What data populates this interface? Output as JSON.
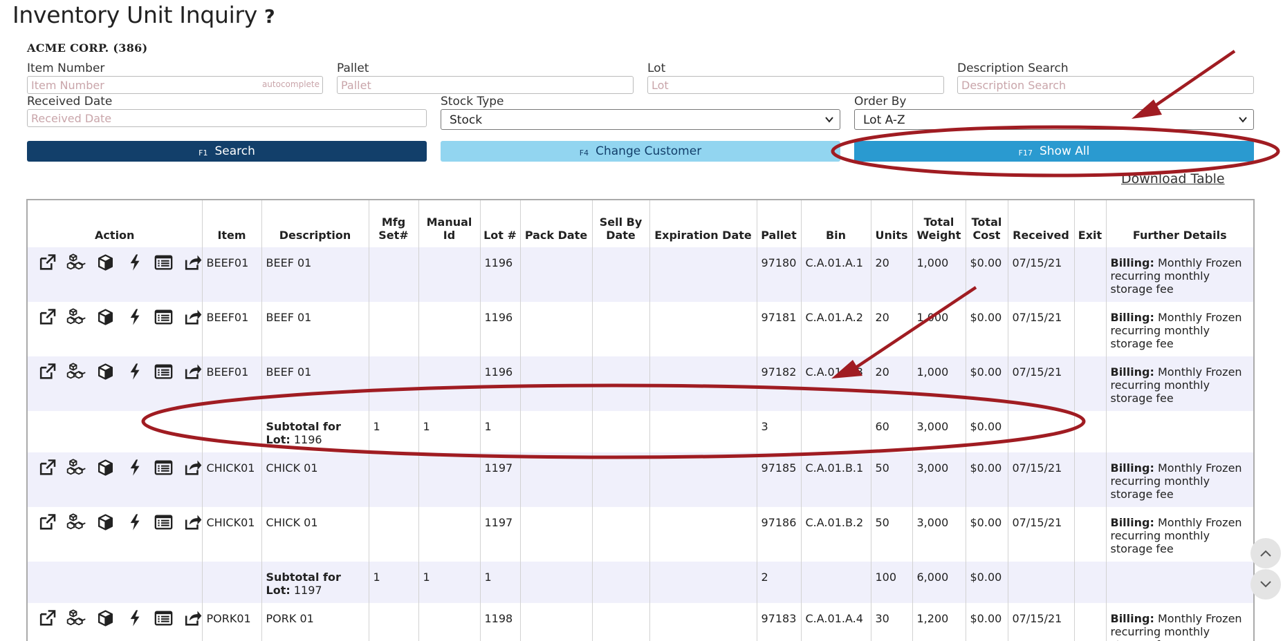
{
  "page": {
    "title": "Inventory Unit Inquiry",
    "help": "?",
    "customer": "ACME CORP. (386)"
  },
  "filters": {
    "item_number": {
      "label": "Item Number",
      "placeholder": "Item Number",
      "hint": "autocomplete"
    },
    "pallet": {
      "label": "Pallet",
      "placeholder": "Pallet"
    },
    "lot": {
      "label": "Lot",
      "placeholder": "Lot"
    },
    "description_search": {
      "label": "Description Search",
      "placeholder": "Description Search"
    },
    "received_date": {
      "label": "Received Date",
      "placeholder": "Received Date"
    },
    "stock_type": {
      "label": "Stock Type",
      "value": "Stock"
    },
    "order_by": {
      "label": "Order By",
      "value": "Lot A-Z"
    }
  },
  "buttons": {
    "search": {
      "fkey": "F1",
      "label": "Search"
    },
    "change_customer": {
      "fkey": "F4",
      "label": "Change Customer"
    },
    "show_all": {
      "fkey": "F17",
      "label": "Show All"
    },
    "download": "Download Table"
  },
  "colors": {
    "search_button": "#123f6a",
    "change_customer_button": "#92d5f0",
    "show_all_button": "#2a9ad0",
    "annotation": "#a01c22",
    "row_alt": "#f0f0fb"
  },
  "table": {
    "columns": [
      "Action",
      "Item",
      "Description",
      "Mfg Set#",
      "Manual Id",
      "Lot #",
      "Pack Date",
      "Sell By Date",
      "Expiration Date",
      "Pallet",
      "Bin",
      "Units",
      "Total Weight",
      "Total Cost",
      "Received",
      "Exit",
      "Further Details"
    ],
    "action_icons": [
      "external-link-icon",
      "boxes-icon",
      "box-icon",
      "bolt-icon",
      "list-icon",
      "share-icon"
    ],
    "billing_label": "Billing:",
    "subtotal_label": "Subtotal for",
    "subtotal_lot_label": "Lot:",
    "rows": [
      {
        "type": "data",
        "item": "BEEF01",
        "description": "BEEF 01",
        "mfg_set": "",
        "manual_id": "",
        "lot": "1196",
        "pack_date": "",
        "sell_by": "",
        "expiration": "",
        "pallet": "97180",
        "bin": "C.A.01.A.1",
        "units": "20",
        "weight": "1,000",
        "cost": "$0.00",
        "received": "07/15/21",
        "exit": "",
        "details": "Monthly Frozen recurring monthly storage fee"
      },
      {
        "type": "data",
        "item": "BEEF01",
        "description": "BEEF 01",
        "mfg_set": "",
        "manual_id": "",
        "lot": "1196",
        "pack_date": "",
        "sell_by": "",
        "expiration": "",
        "pallet": "97181",
        "bin": "C.A.01.A.2",
        "units": "20",
        "weight": "1,000",
        "cost": "$0.00",
        "received": "07/15/21",
        "exit": "",
        "details": "Monthly Frozen recurring monthly storage fee"
      },
      {
        "type": "data",
        "item": "BEEF01",
        "description": "BEEF 01",
        "mfg_set": "",
        "manual_id": "",
        "lot": "1196",
        "pack_date": "",
        "sell_by": "",
        "expiration": "",
        "pallet": "97182",
        "bin": "C.A.01.A.3",
        "units": "20",
        "weight": "1,000",
        "cost": "$0.00",
        "received": "07/15/21",
        "exit": "",
        "details": "Monthly Frozen recurring monthly storage fee"
      },
      {
        "type": "subtotal",
        "lot_value": "1196",
        "mfg_set": "1",
        "manual_id": "1",
        "lot": "1",
        "pallet": "3",
        "units": "60",
        "weight": "3,000",
        "cost": "$0.00"
      },
      {
        "type": "data",
        "item": "CHICK01",
        "description": "CHICK 01",
        "mfg_set": "",
        "manual_id": "",
        "lot": "1197",
        "pack_date": "",
        "sell_by": "",
        "expiration": "",
        "pallet": "97185",
        "bin": "C.A.01.B.1",
        "units": "50",
        "weight": "3,000",
        "cost": "$0.00",
        "received": "07/15/21",
        "exit": "",
        "details": "Monthly Frozen recurring monthly storage fee"
      },
      {
        "type": "data",
        "item": "CHICK01",
        "description": "CHICK 01",
        "mfg_set": "",
        "manual_id": "",
        "lot": "1197",
        "pack_date": "",
        "sell_by": "",
        "expiration": "",
        "pallet": "97186",
        "bin": "C.A.01.B.2",
        "units": "50",
        "weight": "3,000",
        "cost": "$0.00",
        "received": "07/15/21",
        "exit": "",
        "details": "Monthly Frozen recurring monthly storage fee"
      },
      {
        "type": "subtotal",
        "lot_value": "1197",
        "mfg_set": "1",
        "manual_id": "1",
        "lot": "1",
        "pallet": "2",
        "units": "100",
        "weight": "6,000",
        "cost": "$0.00"
      },
      {
        "type": "data",
        "item": "PORK01",
        "description": "PORK 01",
        "mfg_set": "",
        "manual_id": "",
        "lot": "1198",
        "pack_date": "",
        "sell_by": "",
        "expiration": "",
        "pallet": "97183",
        "bin": "C.A.01.A.4",
        "units": "30",
        "weight": "1,200",
        "cost": "$0.00",
        "received": "07/15/21",
        "exit": "",
        "details": "Monthly Frozen recurring monthly storage fee"
      }
    ]
  },
  "scroll": {
    "up_icon": "chevron-up-icon",
    "down_icon": "chevron-down-icon"
  }
}
